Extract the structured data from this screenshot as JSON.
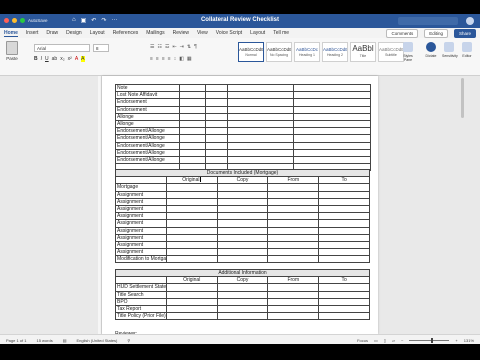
{
  "app": {
    "autosave": "AutoSave",
    "doc_title": "Collateral Review Checklist",
    "search_placeholder": ""
  },
  "tabs": [
    "Home",
    "Insert",
    "Draw",
    "Design",
    "Layout",
    "References",
    "Mailings",
    "Review",
    "View",
    "Voice Script",
    "Layout",
    "Tell me"
  ],
  "tab_right": {
    "comments": "Comments",
    "editing": "Editing",
    "share": "Share"
  },
  "ribbon": {
    "paste_label": "Paste",
    "font_name": "Arial",
    "font_size": "8",
    "styles": [
      {
        "sample": "AaBbCcDdEe",
        "name": "Normal",
        "big": false
      },
      {
        "sample": "AaBbCcDdEe",
        "name": "No Spacing",
        "big": false
      },
      {
        "sample": "AaBbCcDc",
        "name": "Heading 1",
        "big": false
      },
      {
        "sample": "AaBbCcDdE",
        "name": "Heading 2",
        "big": false
      },
      {
        "sample": "AaBbl",
        "name": "Title",
        "big": true
      },
      {
        "sample": "AaBbCcDdEe",
        "name": "Subtitle",
        "big": false
      }
    ],
    "styles_pane": "Styles Pane",
    "tools": [
      "Dictate",
      "Sensitivity",
      "Editor"
    ]
  },
  "table1": {
    "rows": [
      "Note",
      "Lost Note Affidavit",
      "Endorsement",
      "Endorsement",
      "Allonge",
      "Allonge",
      "Endorsement/Allonge",
      "Endorsement/Allonge",
      "Endorsement/Allonge",
      "Endorsement/Allonge",
      "Endorsement/Allonge"
    ]
  },
  "table2": {
    "title": "Documents Included (Mortgage)",
    "headers": [
      "",
      "Original",
      "Copy",
      "From",
      "To"
    ],
    "rows": [
      "Mortgage",
      "Assignment",
      "Assignment",
      "Assignment",
      "Assignment",
      "Assignment",
      "Assignment",
      "Assignment",
      "Assignment",
      "Assignment",
      "Modification to Mortgage"
    ]
  },
  "table3": {
    "title": "Additional Information",
    "headers": [
      "",
      "Original",
      "Copy",
      "From",
      "To"
    ],
    "rows": [
      "HUD Settlement Statement",
      "Title Search",
      "BPO",
      "Tax Report",
      "Title Policy (Prior File)"
    ]
  },
  "reviewer_label": "Reviewer:",
  "status": {
    "page": "Page 1 of 1",
    "words": "15 words",
    "language": "English (United States)",
    "focus": "Focus",
    "zoom": "131%"
  }
}
